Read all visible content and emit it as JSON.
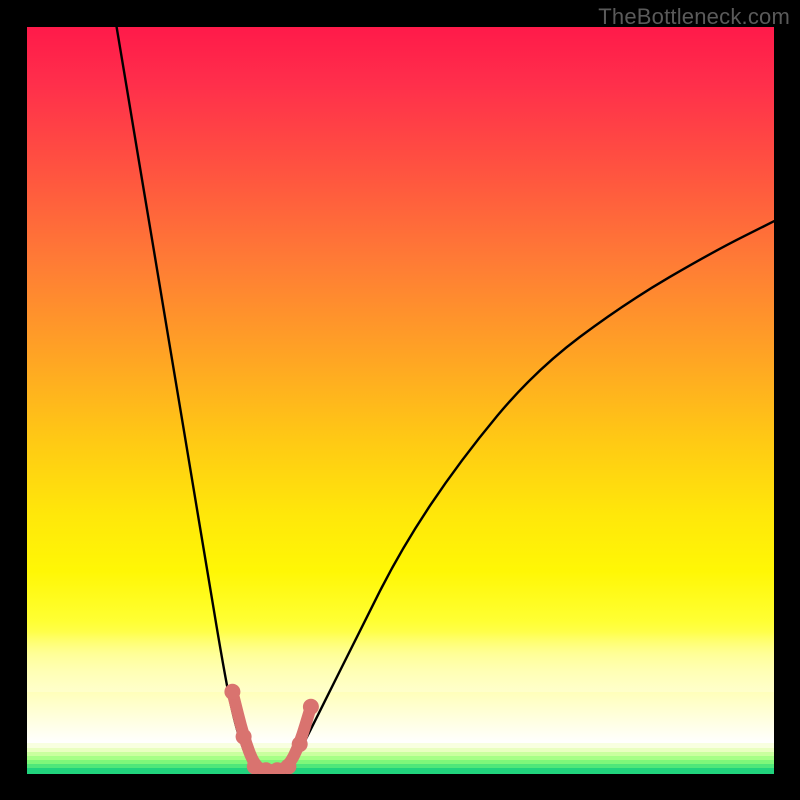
{
  "watermark": "TheBottleneck.com",
  "chart_data": {
    "type": "line",
    "title": "",
    "xlabel": "",
    "ylabel": "",
    "xlim": [
      0,
      100
    ],
    "ylim": [
      0,
      100
    ],
    "series": [
      {
        "name": "left-branch",
        "x": [
          12,
          14,
          16,
          18,
          20,
          22,
          24,
          26,
          27.5,
          29,
          30.5
        ],
        "y": [
          100,
          88,
          76,
          64,
          52,
          40,
          28,
          16,
          8,
          3,
          0
        ]
      },
      {
        "name": "right-branch",
        "x": [
          35,
          37,
          40,
          44,
          50,
          58,
          68,
          80,
          92,
          100
        ],
        "y": [
          0,
          4,
          10,
          18,
          30,
          42,
          54,
          63,
          70,
          74
        ]
      },
      {
        "name": "valley-floor",
        "x": [
          30.5,
          31.5,
          33,
          34,
          35
        ],
        "y": [
          0,
          0,
          0,
          0,
          0
        ]
      }
    ],
    "markers": {
      "name": "highlighted-region",
      "x": [
        27.5,
        29,
        30.5,
        32,
        33.5,
        35,
        36.5,
        38
      ],
      "y": [
        11,
        5,
        1,
        0.5,
        0.5,
        1,
        4,
        9
      ]
    },
    "background_gradient": {
      "orientation": "vertical",
      "stops": [
        {
          "pos": 0.0,
          "color": "#ff1a4a"
        },
        {
          "pos": 0.3,
          "color": "#ff7c35"
        },
        {
          "pos": 0.55,
          "color": "#ffca14"
        },
        {
          "pos": 0.78,
          "color": "#fff705"
        },
        {
          "pos": 0.92,
          "color": "#ffffd9"
        },
        {
          "pos": 1.0,
          "color": "#21d37d"
        }
      ]
    }
  }
}
